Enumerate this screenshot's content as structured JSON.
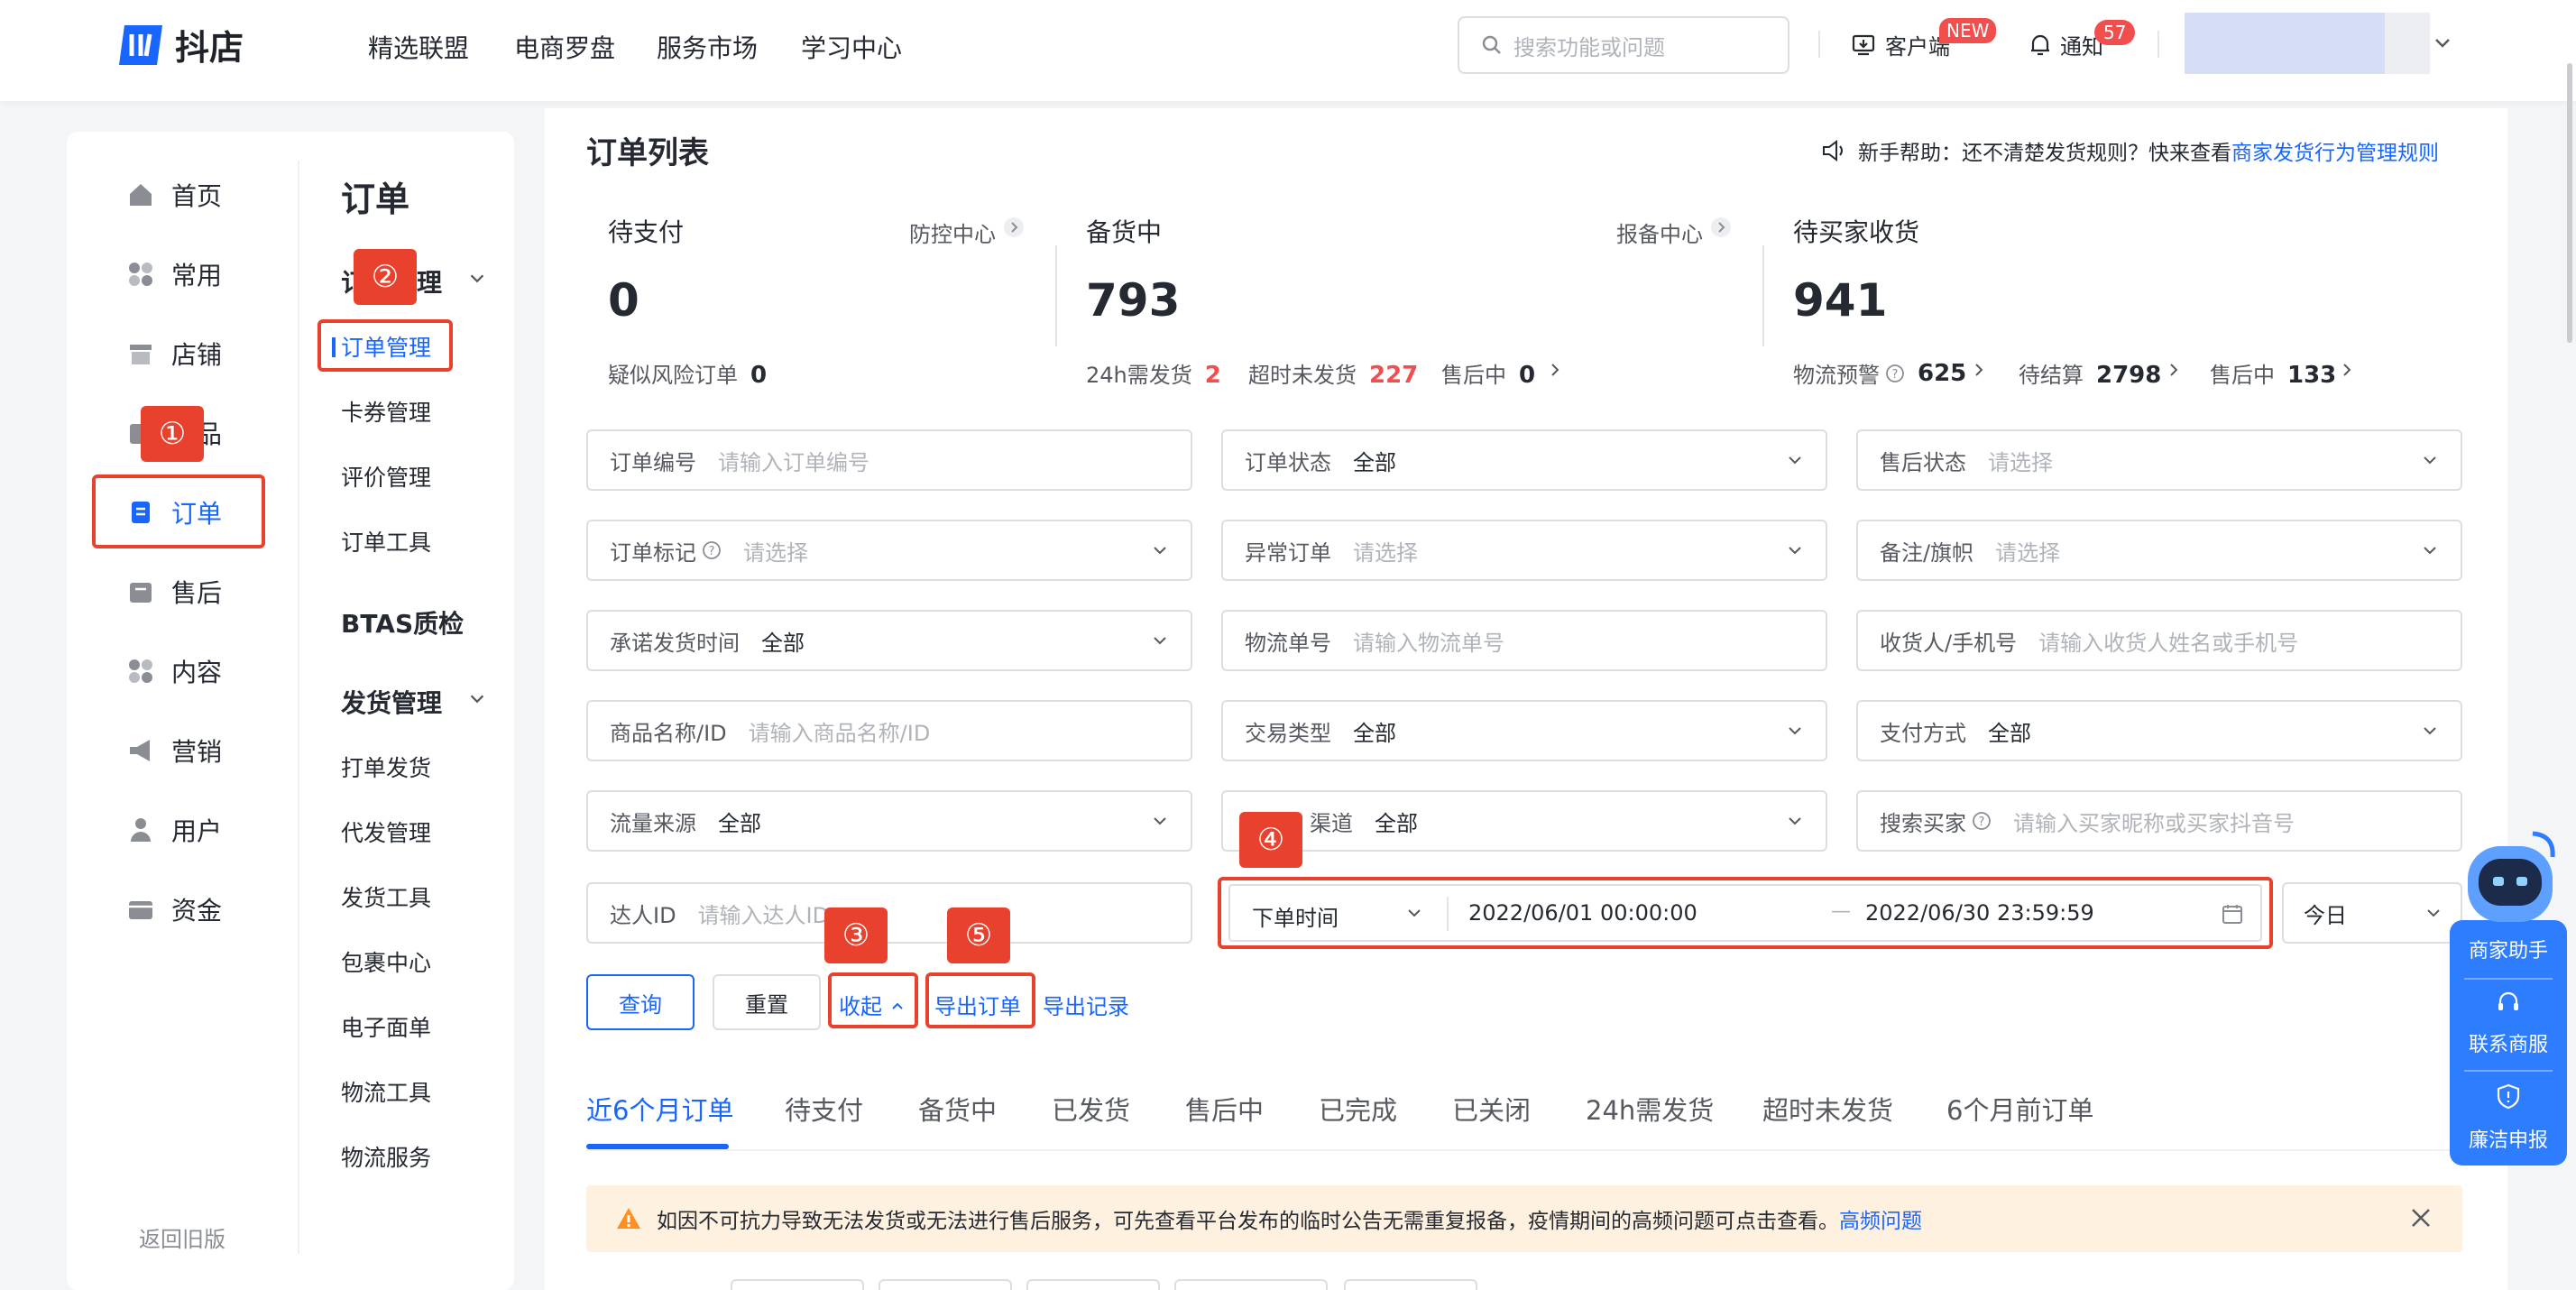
{
  "app": {
    "logo_text": "抖店",
    "nav": [
      "精选联盟",
      "电商罗盘",
      "服务市场",
      "学习中心"
    ],
    "search_placeholder": "搜索功能或问题",
    "client_label": "客户端",
    "client_badge": "NEW",
    "notify_label": "通知",
    "notify_count": "57"
  },
  "sidebar": {
    "items": [
      {
        "label": "首页",
        "icon": "home-icon"
      },
      {
        "label": "常用",
        "icon": "apps-icon"
      },
      {
        "label": "店铺",
        "icon": "store-icon"
      },
      {
        "label": "商品",
        "icon": "product-icon"
      },
      {
        "label": "订单",
        "icon": "order-icon"
      },
      {
        "label": "售后",
        "icon": "aftersale-icon"
      },
      {
        "label": "内容",
        "icon": "content-icon"
      },
      {
        "label": "营销",
        "icon": "megaphone-icon"
      },
      {
        "label": "用户",
        "icon": "user-icon"
      },
      {
        "label": "资金",
        "icon": "wallet-icon"
      }
    ],
    "back_old": "返回旧版"
  },
  "subnav": {
    "title": "订单",
    "group1": "订单管理",
    "items1": [
      "订单管理",
      "卡券管理",
      "评价管理",
      "订单工具"
    ],
    "btas": "BTAS质检",
    "group2": "发货管理",
    "items2": [
      "打单发货",
      "代发管理",
      "发货工具",
      "包裹中心",
      "电子面单",
      "物流工具",
      "物流服务"
    ]
  },
  "main": {
    "title": "订单列表",
    "help_prefix": "新手帮助：还不清楚发货规则？快来查看",
    "help_link": "商家发货行为管理规则"
  },
  "stats": {
    "pending_pay": {
      "label": "待支付",
      "link": "防控中心",
      "value": "0",
      "sub_label": "疑似风险订单",
      "sub_value": "0"
    },
    "stocking": {
      "label": "备货中",
      "link": "报备中心",
      "value": "793",
      "subs": [
        {
          "label": "24h需发货",
          "value": "2"
        },
        {
          "label": "超时未发货",
          "value": "227"
        },
        {
          "label": "售后中",
          "value": "0"
        }
      ]
    },
    "awaiting_receipt": {
      "label": "待买家收货",
      "value": "941",
      "subs": [
        {
          "label": "物流预警",
          "value": "625"
        },
        {
          "label": "待结算",
          "value": "2798"
        },
        {
          "label": "售后中",
          "value": "133"
        }
      ]
    }
  },
  "filters": [
    {
      "label": "订单编号",
      "placeholder": "请输入订单编号"
    },
    {
      "label": "订单状态",
      "value": "全部"
    },
    {
      "label": "售后状态",
      "placeholder": "请选择"
    },
    {
      "label": "订单标记",
      "placeholder": "请选择"
    },
    {
      "label": "异常订单",
      "placeholder": "请选择"
    },
    {
      "label": "备注/旗帜",
      "placeholder": "请选择"
    },
    {
      "label": "承诺发货时间",
      "value": "全部"
    },
    {
      "label": "物流单号",
      "placeholder": "请输入物流单号"
    },
    {
      "label": "收货人/手机号",
      "placeholder": "请输入收货人姓名或手机号"
    },
    {
      "label": "商品名称/ID",
      "placeholder": "请输入商品名称/ID"
    },
    {
      "label": "交易类型",
      "value": "全部"
    },
    {
      "label": "支付方式",
      "value": "全部"
    },
    {
      "label": "流量来源",
      "value": "全部"
    },
    {
      "label": "渠道",
      "value": "全部"
    },
    {
      "label": "搜索买家",
      "placeholder": "请输入买家昵称或买家抖音号"
    },
    {
      "label": "达人ID",
      "placeholder": "请输入达人ID"
    }
  ],
  "date_filter": {
    "type": "下单时间",
    "start": "2022/06/01 00:00:00",
    "sep": "—",
    "end": "2022/06/30 23:59:59",
    "preset": "今日"
  },
  "actions": {
    "query": "查询",
    "reset": "重置",
    "collapse": "收起",
    "export": "导出订单",
    "export_log": "导出记录"
  },
  "tabs": [
    "近6个月订单",
    "待支付",
    "备货中",
    "已发货",
    "售后中",
    "已完成",
    "已关闭",
    "24h需发货",
    "超时未发货",
    "6个月前订单"
  ],
  "notice": {
    "text": "如因不可抗力导致无法发货或无法进行售后服务，可先查看平台发布的临时公告无需重复报备，疫情期间的高频问题可点击查看。",
    "link": "高频问题"
  },
  "annotations": [
    "①",
    "②",
    "③",
    "④",
    "⑤"
  ],
  "assistant": {
    "items": [
      "商家助手",
      "联系商服",
      "廉洁申报"
    ]
  },
  "colors": {
    "accent": "#1966ff",
    "annotation": "#e8412d",
    "warning": "#f24e4e",
    "notice_bg": "#fff1e0"
  }
}
